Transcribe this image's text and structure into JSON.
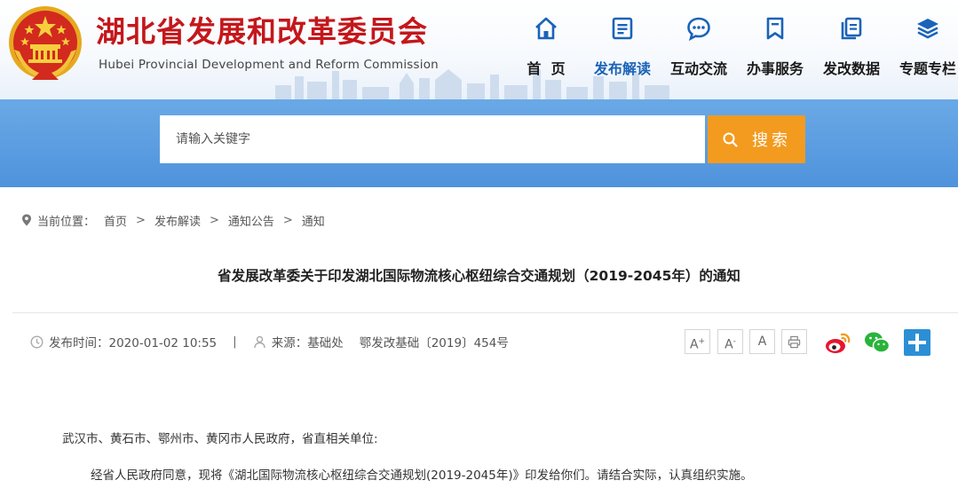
{
  "header": {
    "title": "湖北省发展和改革委员会",
    "subtitle": "Hubei Provincial Development and Reform Commission"
  },
  "nav": {
    "items": [
      {
        "label": "首  页",
        "icon": "home-icon"
      },
      {
        "label": "发布解读",
        "icon": "document-icon",
        "active": true
      },
      {
        "label": "互动交流",
        "icon": "chat-bubble-icon"
      },
      {
        "label": "办事服务",
        "icon": "bookmark-icon"
      },
      {
        "label": "发改数据",
        "icon": "data-pages-icon"
      },
      {
        "label": "专题专栏",
        "icon": "layers-icon"
      }
    ]
  },
  "search": {
    "placeholder": "请输入关键字",
    "button_label": "搜索"
  },
  "breadcrumb": {
    "prefix": "当前位置：",
    "items": [
      "首页",
      "发布解读",
      "通知公告",
      "通知"
    ],
    "separator": ">"
  },
  "article": {
    "title": "省发展改革委关于印发湖北国际物流核心枢纽综合交通规划（2019-2045年）的通知",
    "publish_time": "发布时间：2020-01-02 10:55",
    "separator": "|",
    "source": "来源：基础处",
    "doc_number": "鄂发改基础〔2019〕454号",
    "body": [
      "武汉市、黄石市、鄂州市、黄冈市人民政府，省直相关单位:",
      "经省人民政府同意，现将《湖北国际物流核心枢纽综合交通规划(2019-2045年)》印发给你们。请结合实际，认真组织实施。"
    ]
  },
  "tools": {
    "font_large": "A",
    "font_large_sup": "+",
    "font_small": "A",
    "font_small_sup": "-",
    "font_reset": "A"
  },
  "colors": {
    "title_red": "#c4171b",
    "accent_blue": "#1a63b8",
    "band_blue": "#5a9be0",
    "search_orange": "#f39b1f"
  }
}
